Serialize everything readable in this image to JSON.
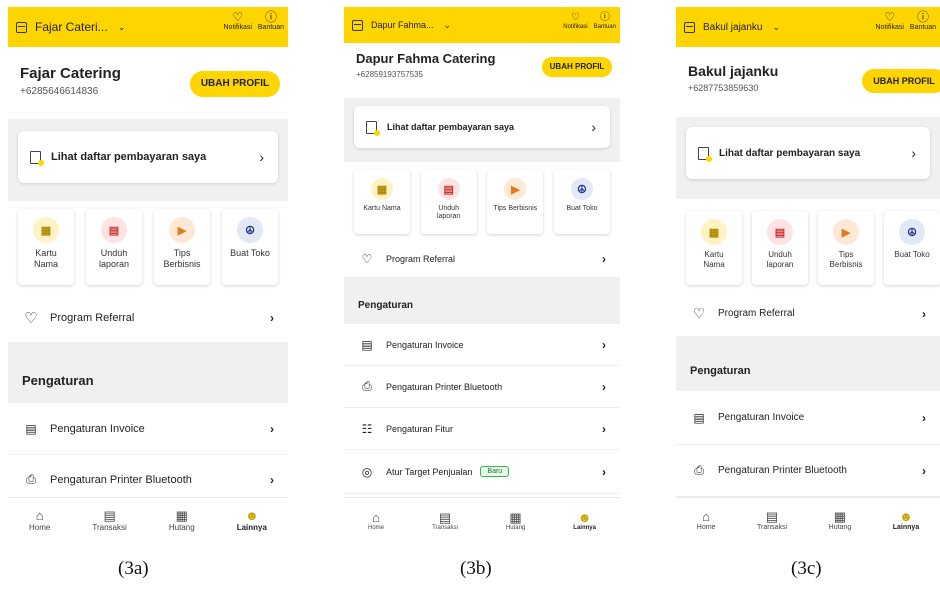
{
  "colors": {
    "brand_yellow": "#FFD500",
    "badge_green": "#37b24d"
  },
  "phones": [
    {
      "store_name": "Fajar Cateri...",
      "notif_label": "Notifikasi",
      "help_label": "Bantuan",
      "profile_name": "Fajar Catering",
      "profile_phone": "+6285646614836",
      "edit_profile": "UBAH PROFIL",
      "payments_label": "Lihat daftar pembayaran saya",
      "tiles": [
        "Kartu Nama",
        "Unduh laporan",
        "Tips Berbisnis",
        "Buat Toko"
      ],
      "referral": "Program Referral",
      "settings_header": "Pengaturan",
      "settings": [
        "Pengaturan Invoice",
        "Pengaturan Printer Bluetooth"
      ],
      "nav": [
        "Home",
        "Transaksi",
        "Hutang",
        "Lainnya"
      ],
      "caption": "(3a)"
    },
    {
      "store_name": "Dapur Fahma...",
      "notif_label": "Notifikasi",
      "help_label": "Bantuan",
      "profile_name": "Dapur Fahma Catering",
      "profile_phone": "+6285919375753​5",
      "edit_profile": "UBAH PROFIL",
      "payments_label": "Lihat daftar pembayaran saya",
      "tiles": [
        "Kartu Nama",
        "Unduh laporan",
        "Tips Berbisnis",
        "Buat Toko"
      ],
      "referral": "Program Referral",
      "settings_header": "Pengaturan",
      "settings": [
        "Pengaturan Invoice",
        "Pengaturan Printer Bluetooth",
        "Pengaturan Fitur",
        "Atur Target Penjualan"
      ],
      "new_badge": "Baru",
      "nav": [
        "Home",
        "Transaksi",
        "Hutang",
        "Lainnya"
      ],
      "caption": "(3b)"
    },
    {
      "store_name": "Bakul jajanku",
      "notif_label": "Notifikasi",
      "help_label": "Bantuan",
      "profile_name": "Bakul jajanku",
      "profile_phone": "+6287753859630",
      "edit_profile": "UBAH PROFIL",
      "payments_label": "Lihat daftar pembayaran saya",
      "tiles": [
        "Kartu Nama",
        "Unduh laporan",
        "Tips Berbisnis",
        "Buat Toko"
      ],
      "referral": "Program Referral",
      "settings_header": "Pengaturan",
      "settings": [
        "Pengaturan Invoice",
        "Pengaturan Printer Bluetooth"
      ],
      "nav": [
        "Home",
        "Transaksi",
        "Hutang",
        "Lainnya"
      ],
      "caption": "(3c)"
    }
  ]
}
